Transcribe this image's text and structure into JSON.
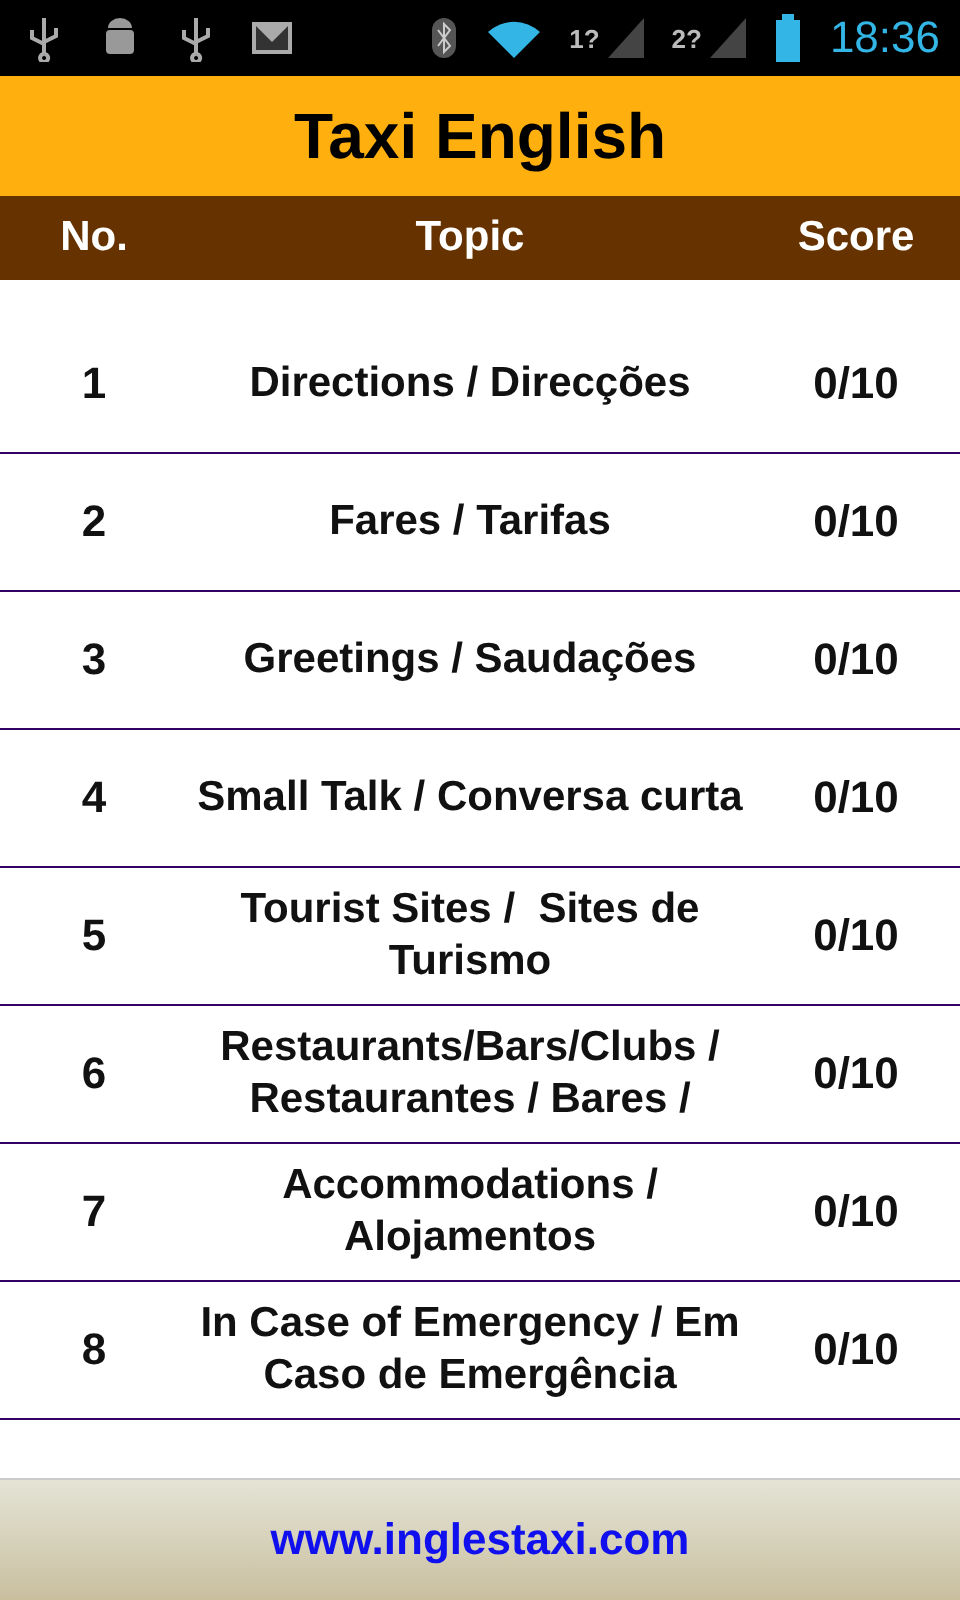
{
  "status_bar": {
    "sim_labels": [
      "1?",
      "2?"
    ],
    "time": "18:36"
  },
  "title": "Taxi English",
  "table": {
    "columns": [
      "No.",
      "Topic",
      "Score"
    ],
    "rows": [
      {
        "no": "1",
        "topic": "Directions / Direcções",
        "score": "0/10"
      },
      {
        "no": "2",
        "topic": "Fares / Tarifas",
        "score": "0/10"
      },
      {
        "no": "3",
        "topic": "Greetings / Saudações",
        "score": "0/10"
      },
      {
        "no": "4",
        "topic": "Small Talk / Conversa curta",
        "score": "0/10"
      },
      {
        "no": "5",
        "topic": "Tourist Sites /  Sites de Turismo",
        "score": "0/10"
      },
      {
        "no": "6",
        "topic": "Restaurants/Bars/Clubs / Restaurantes / Bares /",
        "score": "0/10"
      },
      {
        "no": "7",
        "topic": "Accommodations / Alojamentos",
        "score": "0/10"
      },
      {
        "no": "8",
        "topic": "In Case of Emergency / Em Caso de Emergência",
        "score": "0/10"
      }
    ]
  },
  "footer": {
    "link": "www.inglestaxi.com"
  }
}
